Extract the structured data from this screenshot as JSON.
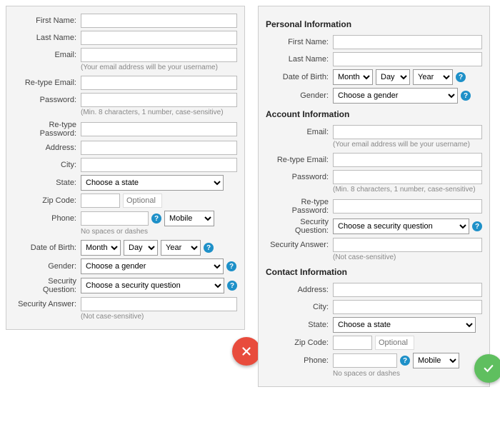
{
  "left": {
    "firstName": {
      "label": "First Name:"
    },
    "lastName": {
      "label": "Last Name:"
    },
    "email": {
      "label": "Email:",
      "hint": "(Your email address will be your username)"
    },
    "retypeEmail": {
      "label": "Re-type Email:"
    },
    "password": {
      "label": "Password:",
      "hint": "(Min. 8 characters, 1 number, case-sensitive)"
    },
    "retypePassword": {
      "label": "Re-type Password:"
    },
    "address": {
      "label": "Address:"
    },
    "city": {
      "label": "City:"
    },
    "state": {
      "label": "State:",
      "placeholder": "Choose a state"
    },
    "zip": {
      "label": "Zip Code:",
      "optional": "Optional"
    },
    "phone": {
      "label": "Phone:",
      "type": "Mobile",
      "hint": "No spaces or dashes"
    },
    "dob": {
      "label": "Date of Birth:",
      "month": "Month",
      "day": "Day",
      "year": "Year"
    },
    "gender": {
      "label": "Gender:",
      "placeholder": "Choose a gender"
    },
    "secQ": {
      "label": "Security Question:",
      "placeholder": "Choose a security question"
    },
    "secA": {
      "label": "Security Answer:",
      "hint": "(Not case-sensitive)"
    }
  },
  "right": {
    "sectionPersonal": "Personal Information",
    "sectionAccount": "Account Information",
    "sectionContact": "Contact Information",
    "firstName": {
      "label": "First Name:"
    },
    "lastName": {
      "label": "Last Name:"
    },
    "dob": {
      "label": "Date of Birth:",
      "month": "Month",
      "day": "Day",
      "year": "Year"
    },
    "gender": {
      "label": "Gender:",
      "placeholder": "Choose a gender"
    },
    "email": {
      "label": "Email:",
      "hint": "(Your email address will be your username)"
    },
    "retypeEmail": {
      "label": "Re-type Email:"
    },
    "password": {
      "label": "Password:",
      "hint": "(Min. 8 characters, 1 number, case-sensitive)"
    },
    "retypePassword": {
      "label": "Re-type Password:"
    },
    "secQ": {
      "label": "Security Question:",
      "placeholder": "Choose a security question"
    },
    "secA": {
      "label": "Security Answer:",
      "hint": "(Not case-sensitive)"
    },
    "address": {
      "label": "Address:"
    },
    "city": {
      "label": "City:"
    },
    "state": {
      "label": "State:",
      "placeholder": "Choose a state"
    },
    "zip": {
      "label": "Zip Code:",
      "optional": "Optional"
    },
    "phone": {
      "label": "Phone:",
      "type": "Mobile",
      "hint": "No spaces or dashes"
    }
  },
  "help": "?",
  "colors": {
    "red": "#e84c3d",
    "green": "#5fbf5f",
    "helpBlue": "#1e90c8"
  }
}
